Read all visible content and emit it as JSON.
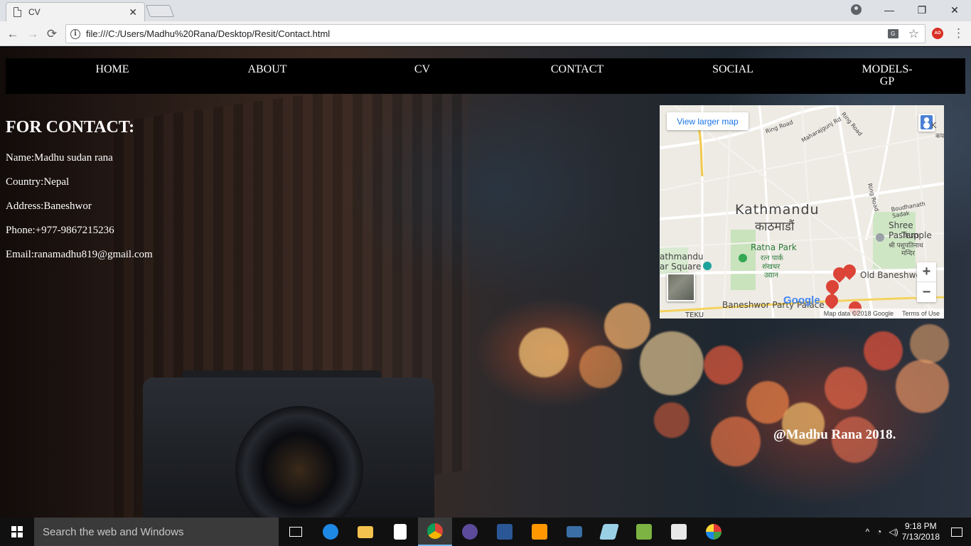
{
  "browser": {
    "tab_title": "CV",
    "tab_close": "✕",
    "url": "file:///C:/Users/Madhu%20Rana/Desktop/Resit/Contact.html",
    "window_buttons": {
      "minimize": "—",
      "restore": "❐",
      "close": "✕"
    },
    "back_glyph": "←",
    "forward_glyph": "→",
    "reload_glyph": "⟳",
    "info_glyph": "i",
    "star_glyph": "☆",
    "menu_glyph": "⋮",
    "ext_label": "AO"
  },
  "nav": {
    "items": [
      {
        "label": "HOME"
      },
      {
        "label": "ABOUT"
      },
      {
        "label": "CV"
      },
      {
        "label": "CONTACT"
      },
      {
        "label": "SOCIAL"
      },
      {
        "label": "MODELS-",
        "label2": "GP"
      }
    ]
  },
  "contact": {
    "heading": "FOR CONTACT:",
    "name": "Name:Madhu sudan rana",
    "country": "Country:Nepal",
    "address": "Address:Baneshwor",
    "phone": "Phone:+977-9867215236",
    "email": "Email:ranamadhu819@gmail.com"
  },
  "map": {
    "view_larger": "View larger map",
    "city": "Kathmandu",
    "city_np": "काठमाडौं",
    "labels": {
      "ratna_park": "Ratna Park",
      "ratna_park_np1": "रत्न पार्क",
      "ratna_park_np2": "शंखधर",
      "ratna_park_np3": "उद्यान",
      "shree_pashu": "Shree Pashup",
      "temple": "Temple",
      "temple_np1": "श्री पशुपतिनाथ",
      "temple_np2": "मन्दिर",
      "old_baneshwor": "Old Baneshwo",
      "party_palace": "Baneshwor Party Palace",
      "durbar1": "athmandu",
      "durbar2": "ar Square",
      "teku": "TEKU",
      "ring_road1": "Ring Road",
      "ring_road2": "Ring Road",
      "ring_road3": "Ring Road",
      "maharajgunj": "Maharajgunj Rd",
      "boudhanath": "Boudhanath Sadak",
      "top_right": "K",
      "top_right_np": "कपन"
    },
    "zoom_in": "+",
    "zoom_out": "−",
    "google": "Google",
    "attribution": "Map data ©2018 Google",
    "terms": "Terms of Use"
  },
  "footer": {
    "text": "@Madhu Rana 2018."
  },
  "taskbar": {
    "search_placeholder": "Search the web and Windows",
    "time": "9:18 PM",
    "date": "7/13/2018",
    "tray_caret": "^"
  }
}
